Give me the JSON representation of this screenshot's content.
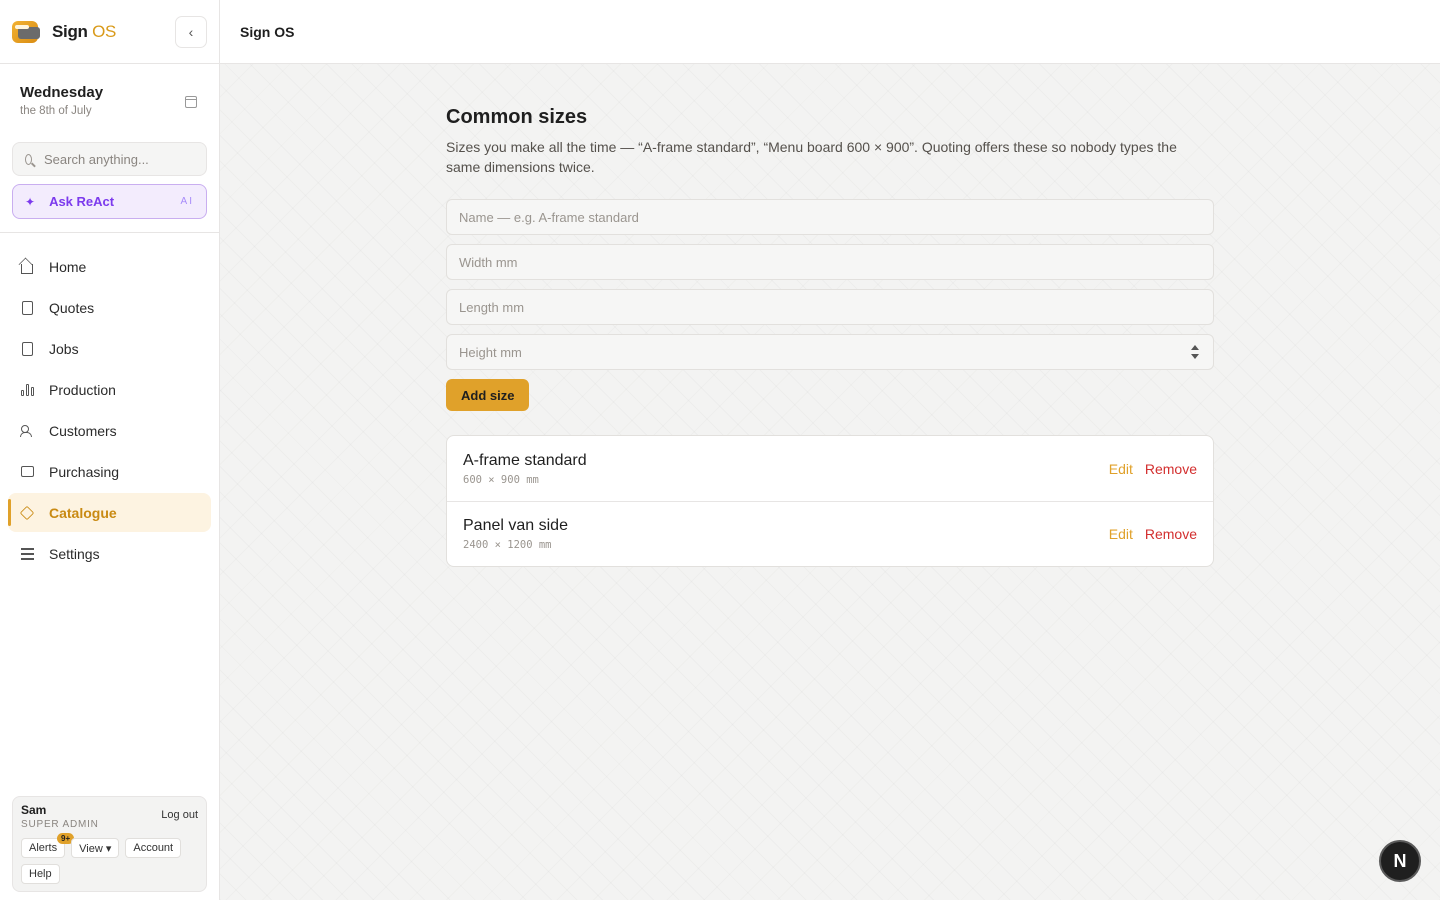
{
  "app": {
    "brand_name": "Sign",
    "brand_suffix": "OS",
    "header_title": "Sign OS"
  },
  "sidebar": {
    "date_day": "Wednesday",
    "date_sub": "the 8th of July",
    "search_placeholder": "Search anything...",
    "ask_label": "Ask ReAct",
    "ask_tag": "AI",
    "nav": [
      {
        "label": "Home",
        "icon": "home-icon"
      },
      {
        "label": "Quotes",
        "icon": "document-icon"
      },
      {
        "label": "Jobs",
        "icon": "clipboard-icon"
      },
      {
        "label": "Production",
        "icon": "bar-chart-icon"
      },
      {
        "label": "Customers",
        "icon": "users-icon"
      },
      {
        "label": "Purchasing",
        "icon": "monitor-icon"
      },
      {
        "label": "Catalogue",
        "icon": "package-icon",
        "active": true
      },
      {
        "label": "Settings",
        "icon": "sliders-icon"
      }
    ],
    "user": {
      "name": "Sam",
      "role": "SUPER ADMIN",
      "logout": "Log out",
      "alerts": "Alerts",
      "alerts_badge": "9+",
      "view": "View ▾",
      "account": "Account",
      "help": "Help"
    }
  },
  "main": {
    "title": "Common sizes",
    "description": "Sizes you make all the time — “A-frame standard”, “Menu board 600 × 900”. Quoting offers these so nobody types the same dimensions twice.",
    "fields": {
      "name_placeholder": "Name — e.g. A-frame standard",
      "width_placeholder": "Width mm",
      "length_placeholder": "Length mm",
      "height_placeholder": "Height mm"
    },
    "add_button": "Add size",
    "sizes": [
      {
        "name": "A-frame standard",
        "dims": "600 × 900 mm",
        "edit": "Edit",
        "remove": "Remove"
      },
      {
        "name": "Panel van side",
        "dims": "2400 × 1200 mm",
        "edit": "Edit",
        "remove": "Remove"
      }
    ]
  },
  "fab_label": "N",
  "colors": {
    "accent": "#e0a12a",
    "danger": "#d32f2f",
    "ai": "#7c3aed"
  }
}
